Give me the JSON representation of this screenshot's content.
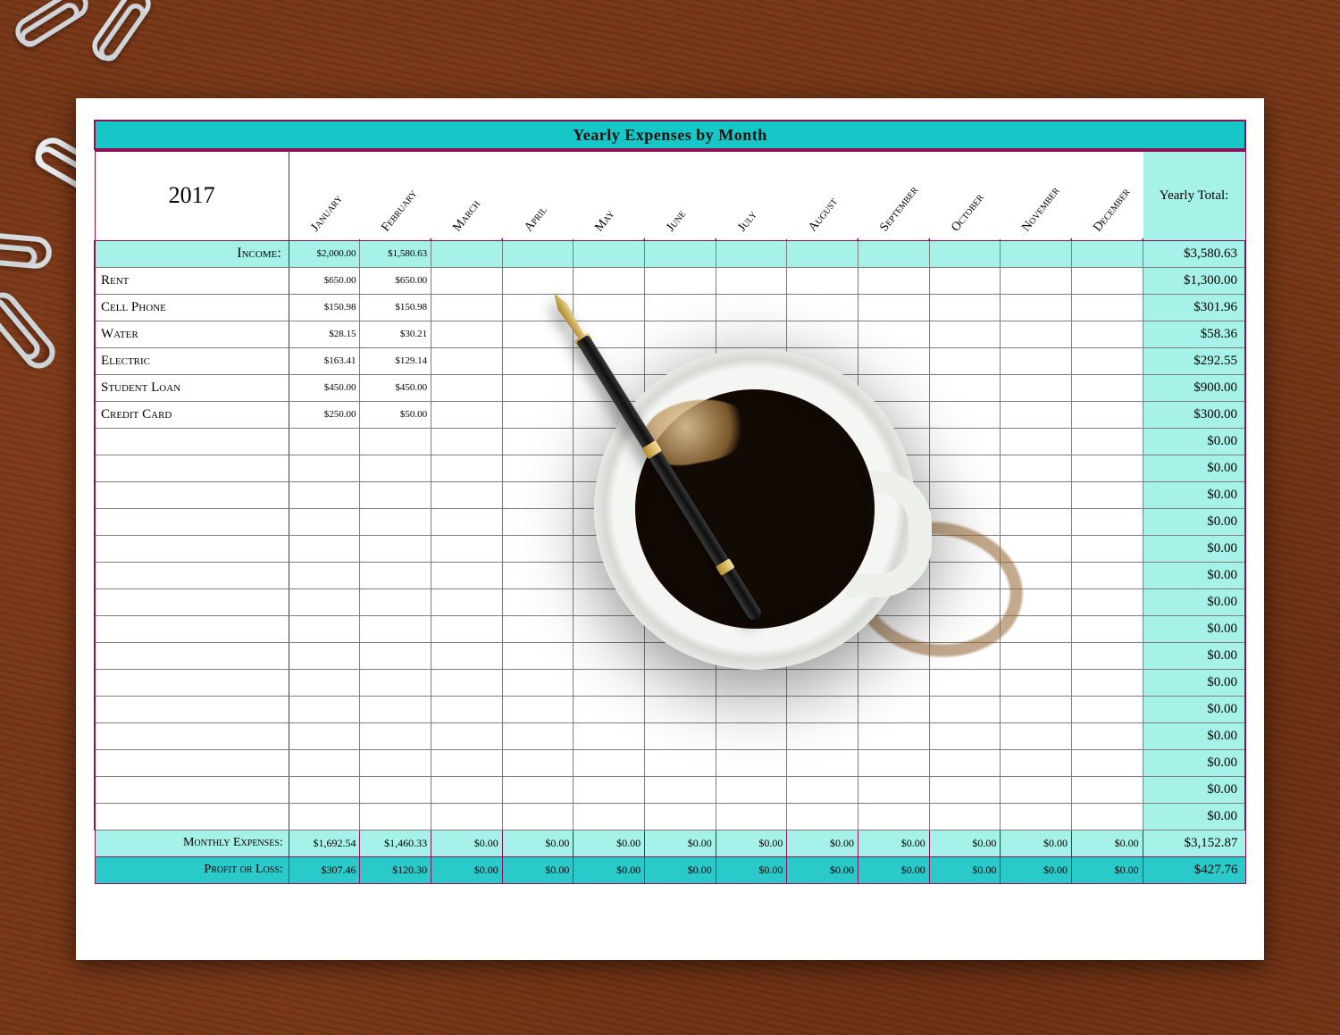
{
  "title": "Yearly Expenses by Month",
  "year": "2017",
  "yearly_total_header": "Yearly Total:",
  "months": [
    "January",
    "February",
    "March",
    "April",
    "May",
    "June",
    "July",
    "August",
    "September",
    "October",
    "November",
    "December"
  ],
  "income": {
    "label": "Income:",
    "values": [
      "$2,000.00",
      "$1,580.63",
      "",
      "",
      "",
      "",
      "",
      "",
      "",
      "",
      "",
      ""
    ],
    "total": "$3,580.63"
  },
  "rows": [
    {
      "label": "Rent",
      "values": [
        "$650.00",
        "$650.00",
        "",
        "",
        "",
        "",
        "",
        "",
        "",
        "",
        "",
        ""
      ],
      "total": "$1,300.00"
    },
    {
      "label": "Cell Phone",
      "values": [
        "$150.98",
        "$150.98",
        "",
        "",
        "",
        "",
        "",
        "",
        "",
        "",
        "",
        ""
      ],
      "total": "$301.96"
    },
    {
      "label": "Water",
      "values": [
        "$28.15",
        "$30.21",
        "",
        "",
        "",
        "",
        "",
        "",
        "",
        "",
        "",
        ""
      ],
      "total": "$58.36"
    },
    {
      "label": "Electric",
      "values": [
        "$163.41",
        "$129.14",
        "",
        "",
        "",
        "",
        "",
        "",
        "",
        "",
        "",
        ""
      ],
      "total": "$292.55"
    },
    {
      "label": "Student Loan",
      "values": [
        "$450.00",
        "$450.00",
        "",
        "",
        "",
        "",
        "",
        "",
        "",
        "",
        "",
        ""
      ],
      "total": "$900.00"
    },
    {
      "label": "Credit Card",
      "values": [
        "$250.00",
        "$50.00",
        "",
        "",
        "",
        "",
        "",
        "",
        "",
        "",
        "",
        ""
      ],
      "total": "$300.00"
    },
    {
      "label": "",
      "values": [
        "",
        "",
        "",
        "",
        "",
        "",
        "",
        "",
        "",
        "",
        "",
        ""
      ],
      "total": "$0.00"
    },
    {
      "label": "",
      "values": [
        "",
        "",
        "",
        "",
        "",
        "",
        "",
        "",
        "",
        "",
        "",
        ""
      ],
      "total": "$0.00"
    },
    {
      "label": "",
      "values": [
        "",
        "",
        "",
        "",
        "",
        "",
        "",
        "",
        "",
        "",
        "",
        ""
      ],
      "total": "$0.00"
    },
    {
      "label": "",
      "values": [
        "",
        "",
        "",
        "",
        "",
        "",
        "",
        "",
        "",
        "",
        "",
        ""
      ],
      "total": "$0.00"
    },
    {
      "label": "",
      "values": [
        "",
        "",
        "",
        "",
        "",
        "",
        "",
        "",
        "",
        "",
        "",
        ""
      ],
      "total": "$0.00"
    },
    {
      "label": "",
      "values": [
        "",
        "",
        "",
        "",
        "",
        "",
        "",
        "",
        "",
        "",
        "",
        ""
      ],
      "total": "$0.00"
    },
    {
      "label": "",
      "values": [
        "",
        "",
        "",
        "",
        "",
        "",
        "",
        "",
        "",
        "",
        "",
        ""
      ],
      "total": "$0.00"
    },
    {
      "label": "",
      "values": [
        "",
        "",
        "",
        "",
        "",
        "",
        "",
        "",
        "",
        "",
        "",
        ""
      ],
      "total": "$0.00"
    },
    {
      "label": "",
      "values": [
        "",
        "",
        "",
        "",
        "",
        "",
        "",
        "",
        "",
        "",
        "",
        ""
      ],
      "total": "$0.00"
    },
    {
      "label": "",
      "values": [
        "",
        "",
        "",
        "",
        "",
        "",
        "",
        "",
        "",
        "",
        "",
        ""
      ],
      "total": "$0.00"
    },
    {
      "label": "",
      "values": [
        "",
        "",
        "",
        "",
        "",
        "",
        "",
        "",
        "",
        "",
        "",
        ""
      ],
      "total": "$0.00"
    },
    {
      "label": "",
      "values": [
        "",
        "",
        "",
        "",
        "",
        "",
        "",
        "",
        "",
        "",
        "",
        ""
      ],
      "total": "$0.00"
    },
    {
      "label": "",
      "values": [
        "",
        "",
        "",
        "",
        "",
        "",
        "",
        "",
        "",
        "",
        "",
        ""
      ],
      "total": "$0.00"
    },
    {
      "label": "",
      "values": [
        "",
        "",
        "",
        "",
        "",
        "",
        "",
        "",
        "",
        "",
        "",
        ""
      ],
      "total": "$0.00"
    },
    {
      "label": "",
      "values": [
        "",
        "",
        "",
        "",
        "",
        "",
        "",
        "",
        "",
        "",
        "",
        ""
      ],
      "total": "$0.00"
    }
  ],
  "monthly_expenses": {
    "label": "Monthly Expenses:",
    "values": [
      "$1,692.54",
      "$1,460.33",
      "$0.00",
      "$0.00",
      "$0.00",
      "$0.00",
      "$0.00",
      "$0.00",
      "$0.00",
      "$0.00",
      "$0.00",
      "$0.00"
    ],
    "total": "$3,152.87"
  },
  "profit_or_loss": {
    "label": "Profit or Loss:",
    "values": [
      "$307.46",
      "$120.30",
      "$0.00",
      "$0.00",
      "$0.00",
      "$0.00",
      "$0.00",
      "$0.00",
      "$0.00",
      "$0.00",
      "$0.00",
      "$0.00"
    ],
    "total": "$427.76"
  },
  "chart_data": {
    "type": "table",
    "title": "Yearly Expenses by Month",
    "year": 2017,
    "columns": [
      "January",
      "February",
      "March",
      "April",
      "May",
      "June",
      "July",
      "August",
      "September",
      "October",
      "November",
      "December",
      "Yearly Total"
    ],
    "income": [
      2000.0,
      1580.63,
      null,
      null,
      null,
      null,
      null,
      null,
      null,
      null,
      null,
      null,
      3580.63
    ],
    "expenses": {
      "Rent": [
        650.0,
        650.0,
        null,
        null,
        null,
        null,
        null,
        null,
        null,
        null,
        null,
        null,
        1300.0
      ],
      "Cell Phone": [
        150.98,
        150.98,
        null,
        null,
        null,
        null,
        null,
        null,
        null,
        null,
        null,
        null,
        301.96
      ],
      "Water": [
        28.15,
        30.21,
        null,
        null,
        null,
        null,
        null,
        null,
        null,
        null,
        null,
        null,
        58.36
      ],
      "Electric": [
        163.41,
        129.14,
        null,
        null,
        null,
        null,
        null,
        null,
        null,
        null,
        null,
        null,
        292.55
      ],
      "Student Loan": [
        450.0,
        450.0,
        null,
        null,
        null,
        null,
        null,
        null,
        null,
        null,
        null,
        null,
        900.0
      ],
      "Credit Card": [
        250.0,
        50.0,
        null,
        null,
        null,
        null,
        null,
        null,
        null,
        null,
        null,
        null,
        300.0
      ]
    },
    "monthly_expenses": [
      1692.54,
      1460.33,
      0,
      0,
      0,
      0,
      0,
      0,
      0,
      0,
      0,
      0,
      3152.87
    ],
    "profit_or_loss": [
      307.46,
      120.3,
      0,
      0,
      0,
      0,
      0,
      0,
      0,
      0,
      0,
      0,
      427.76
    ]
  }
}
